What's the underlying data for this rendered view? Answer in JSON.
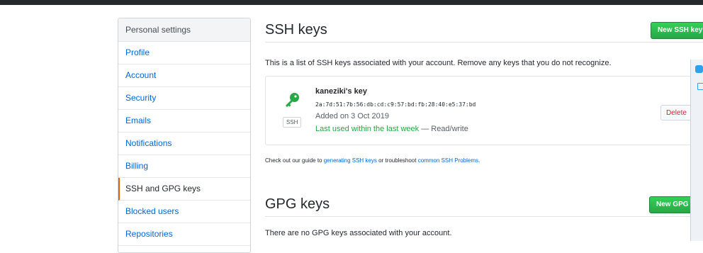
{
  "sidebar": {
    "header": "Personal settings",
    "items": [
      {
        "label": "Profile"
      },
      {
        "label": "Account"
      },
      {
        "label": "Security"
      },
      {
        "label": "Emails"
      },
      {
        "label": "Notifications"
      },
      {
        "label": "Billing"
      },
      {
        "label": "SSH and GPG keys",
        "selected": true
      },
      {
        "label": "Blocked users"
      },
      {
        "label": "Repositories"
      }
    ]
  },
  "ssh": {
    "title": "SSH keys",
    "new_button": "New SSH key",
    "intro": "This is a list of SSH keys associated with your account. Remove any keys that you do not recognize.",
    "key": {
      "title": "kaneziki's key",
      "fingerprint": "2a:7d:51:7b:56:db:cd:c9:57:bd:fb:28:40:e5:37:bd",
      "added": "Added on 3 Oct 2019",
      "last_used": "Last used within the last week",
      "access": " — Read/write",
      "type_badge": "SSH",
      "delete_button": "Delete",
      "icon": "key-icon"
    },
    "guide": {
      "prefix": "Check out our guide to ",
      "link1": "generating SSH keys",
      "middle": " or troubleshoot ",
      "link2": "common SSH Problems",
      "suffix": "."
    }
  },
  "gpg": {
    "title": "GPG keys",
    "new_button": "New GPG",
    "empty": "There are no GPG keys associated with your account."
  },
  "colors": {
    "accent": "#0366d6",
    "selected_border": "#e36209",
    "primary_button": "#28a745",
    "danger": "#cb2431"
  }
}
